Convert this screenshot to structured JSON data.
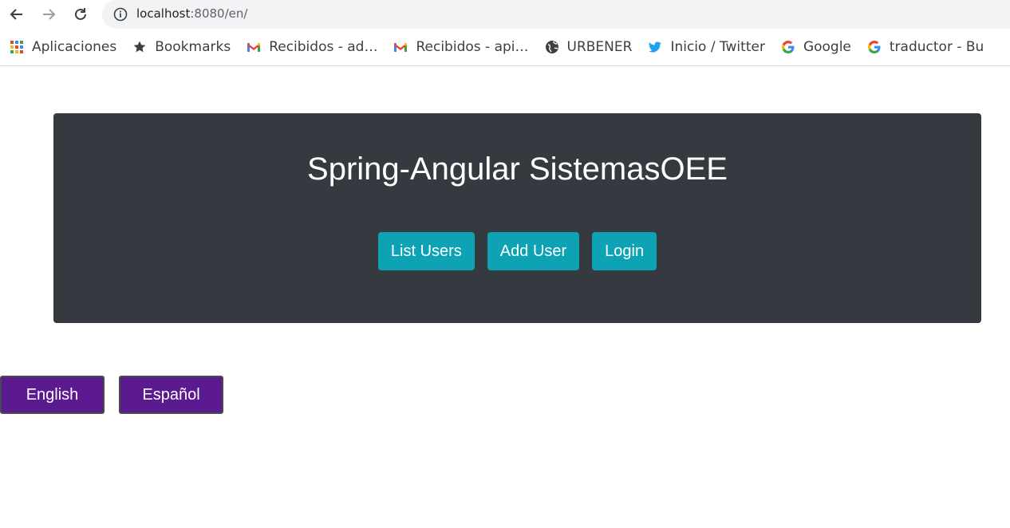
{
  "browser": {
    "url_host": "localhost",
    "url_rest": ":8080/en/",
    "bookmarks": [
      {
        "label": "Aplicaciones",
        "icon": "apps-grid-icon"
      },
      {
        "label": "Bookmarks",
        "icon": "star-icon"
      },
      {
        "label": "Recibidos - ad…",
        "icon": "gmail-icon"
      },
      {
        "label": "Recibidos - api…",
        "icon": "gmail-icon"
      },
      {
        "label": "URBENER",
        "icon": "globe-icon"
      },
      {
        "label": "Inicio / Twitter",
        "icon": "twitter-icon"
      },
      {
        "label": "Google",
        "icon": "google-icon"
      },
      {
        "label": "traductor - Bu",
        "icon": "google-icon"
      }
    ]
  },
  "jumbotron": {
    "title": "Spring-Angular SistemasOEE",
    "buttons": [
      "List Users",
      "Add User",
      "Login"
    ],
    "background": "#343a40",
    "button_color": "#0ea3b4"
  },
  "language": {
    "english": "English",
    "spanish": "Español",
    "button_color": "#5b1a8f"
  }
}
